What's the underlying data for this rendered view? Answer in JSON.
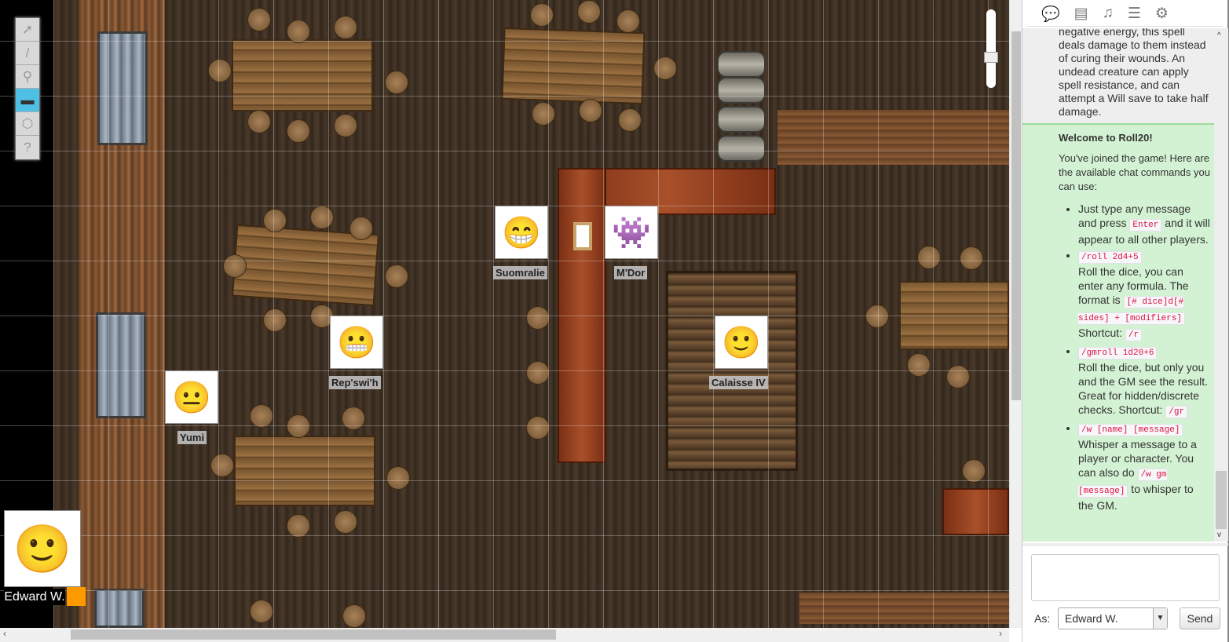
{
  "toolbar": {
    "tools": [
      {
        "name": "select",
        "icon": "➚"
      },
      {
        "name": "draw",
        "icon": "/"
      },
      {
        "name": "zoom",
        "icon": "⚲"
      },
      {
        "name": "measure",
        "icon": "▬"
      },
      {
        "name": "dice",
        "icon": "⬡"
      },
      {
        "name": "help",
        "icon": "?"
      }
    ],
    "active": "measure"
  },
  "tokens": [
    {
      "name": "Suomralie",
      "emoji": "😁"
    },
    {
      "name": "M'Dor",
      "emoji": "👾"
    },
    {
      "name": "Rep'swi'h",
      "emoji": "😬"
    },
    {
      "name": "Yumi",
      "emoji": "😐"
    },
    {
      "name": "Calaisse IV",
      "emoji": "🙂"
    }
  ],
  "player": {
    "name": "Edward W.",
    "color": "#ff9900"
  },
  "sidebar": {
    "tabs": [
      "chat-icon",
      "journal-icon",
      "jukebox-icon",
      "compendium-icon",
      "settings-icon"
    ],
    "tab_glyphs": [
      "💬",
      "▤",
      "♫",
      "☰",
      "⚙"
    ]
  },
  "chat": {
    "msg1": "negative energy, this spell deals damage to them instead of curing their wounds. An undead creature can apply spell resistance, and can attempt a Will save to take half damage.",
    "welcome_title": "Welcome to Roll20!",
    "welcome_intro": "You've joined the game! Here are the available chat commands you can use:",
    "items": [
      {
        "pre": "Just type any message and press ",
        "code": "Enter",
        "post": " and it will appear to all other players."
      },
      {
        "code": "/roll 2d4+5",
        "text": "Roll the dice, you can enter any formula. The format is ",
        "code2": "[# dice]d[# sides] + [modifiers]",
        "shortcut_label": "Shortcut: ",
        "shortcut": "/r"
      },
      {
        "code": "/gmroll 1d20+6",
        "text": "Roll the dice, but only you and the GM see the result. Great for hidden/discrete checks. Shortcut: ",
        "shortcut": "/gr"
      },
      {
        "code": "/w [name] [message]",
        "text": "Whisper a message to a player or character. You can also do ",
        "code2": "/w gm [message]",
        "post": " to whisper to the GM."
      }
    ],
    "input_value": "",
    "as_label": "As:",
    "as_value": "Edward W.",
    "send_label": "Send"
  }
}
